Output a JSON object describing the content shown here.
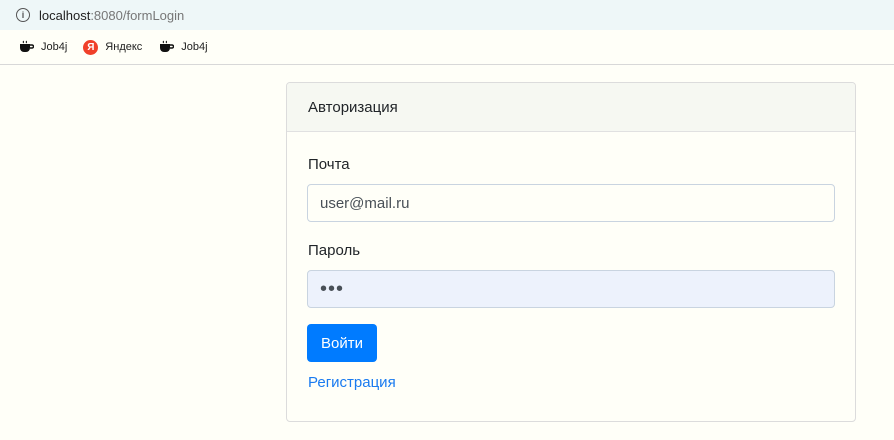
{
  "browser": {
    "url_host": "localhost",
    "url_rest": ":8080/formLogin",
    "info_icon": "info-icon"
  },
  "bookmarks": [
    {
      "label": "Job4j",
      "icon": "job4j-icon"
    },
    {
      "label": "Яндекс",
      "icon": "yandex-icon",
      "icon_text": "Я"
    },
    {
      "label": "Job4j",
      "icon": "job4j-icon"
    }
  ],
  "card": {
    "title": "Авторизация",
    "email_label": "Почта",
    "email_value": "user@mail.ru",
    "password_label": "Пароль",
    "password_value": "•••",
    "login_button": "Войти",
    "register_link": "Регистрация"
  },
  "colors": {
    "accent": "#007bff",
    "link": "#1a7bf0",
    "yandex": "#f0402a"
  }
}
